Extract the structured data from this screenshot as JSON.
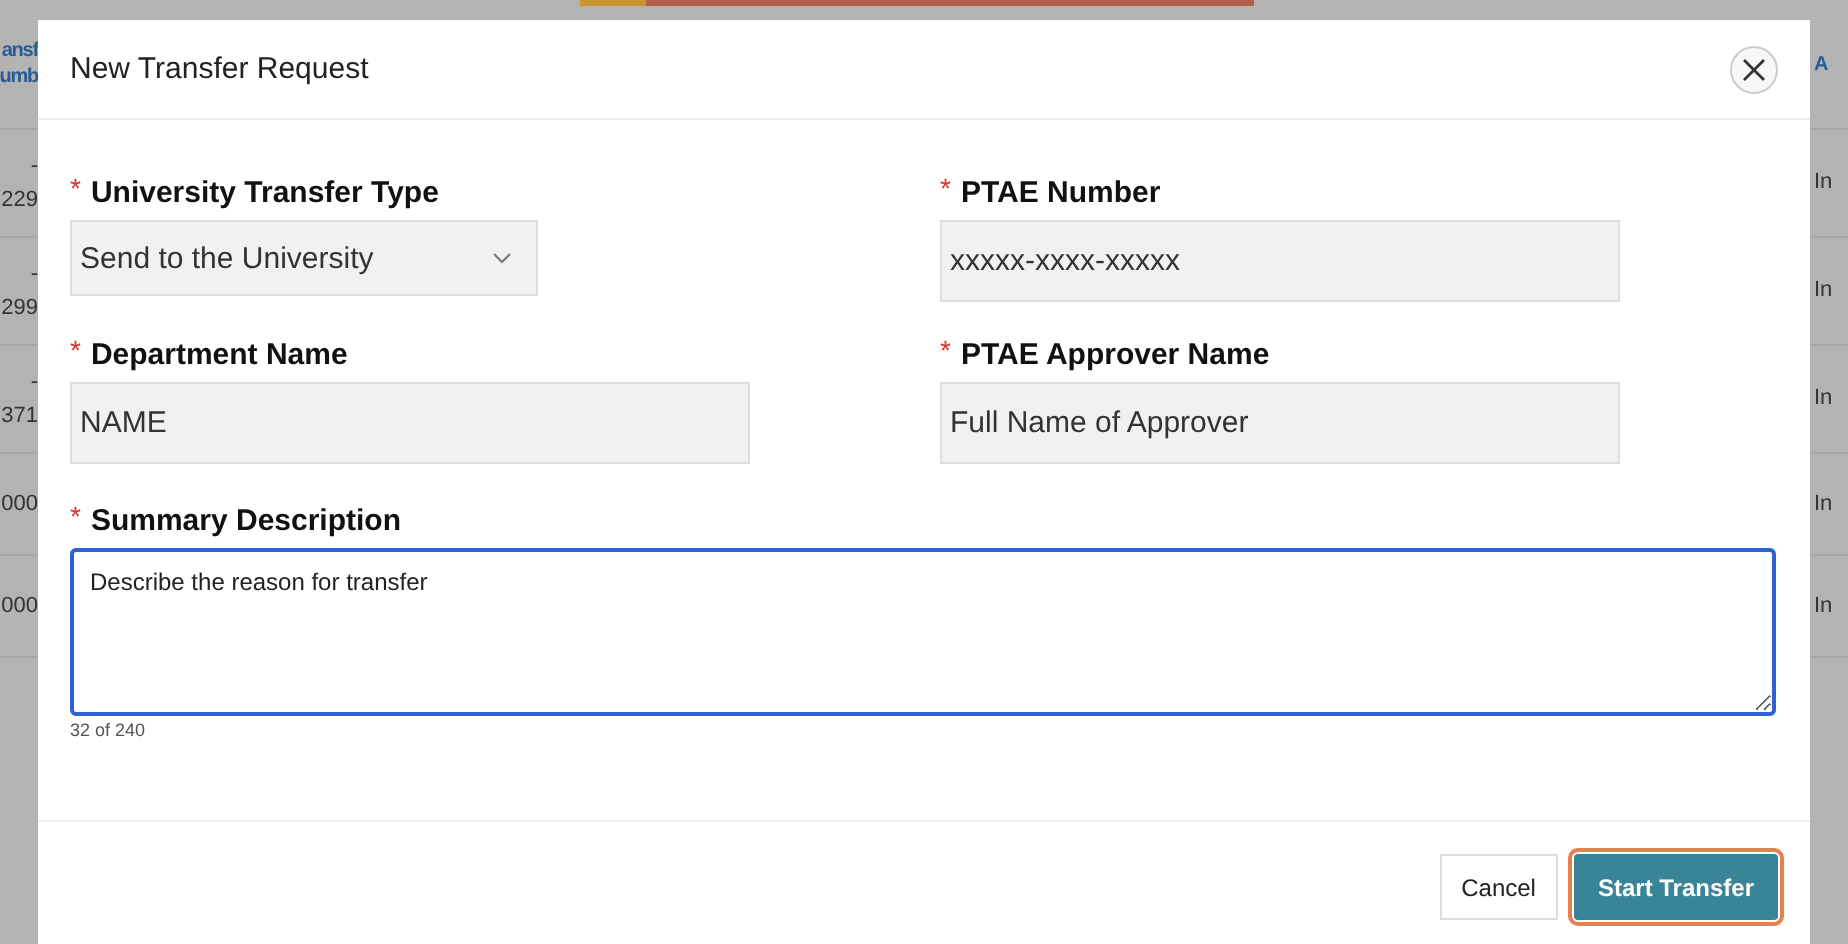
{
  "background_table": {
    "left_column": {
      "header": [
        "ansf",
        "umb"
      ],
      "rows": [
        [
          "-",
          "229"
        ],
        [
          "-",
          "299"
        ],
        [
          "-",
          "371"
        ],
        [
          "000"
        ],
        [
          "000"
        ]
      ]
    },
    "right_column": {
      "header": "A",
      "rows": [
        "In",
        "In",
        "In",
        "In",
        "In"
      ]
    }
  },
  "dialog": {
    "title": "New Transfer Request",
    "fields": [
      {
        "kind": "select",
        "label": "University Transfer Type",
        "required_mark": "*",
        "value": "Send to the University"
      },
      {
        "kind": "text",
        "label": "PTAE Number",
        "required_mark": "*",
        "value": "xxxxx-xxxx-xxxxx"
      },
      {
        "kind": "text",
        "label": "Department Name",
        "required_mark": "*",
        "value": "NAME"
      },
      {
        "kind": "text",
        "label": "PTAE Approver Name",
        "required_mark": "*",
        "value": "Full Name of Approver"
      }
    ],
    "summary": {
      "label": "Summary Description",
      "required_mark": "*",
      "value": "Describe the reason for transfer",
      "focused": true,
      "counter": "32 of 240"
    },
    "buttons": [
      {
        "label": "Cancel",
        "kind": "secondary",
        "focused": false
      },
      {
        "label": "Start Transfer",
        "kind": "primary",
        "focused": true
      }
    ]
  }
}
